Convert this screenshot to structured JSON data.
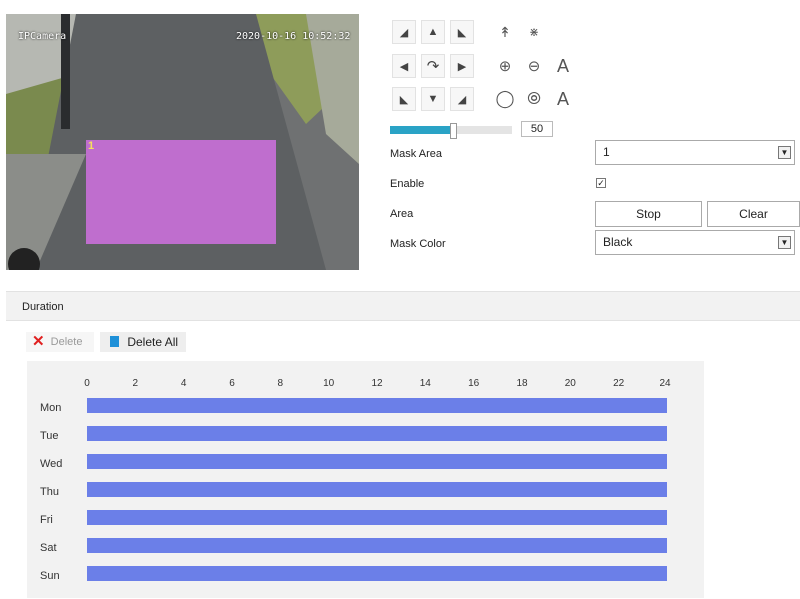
{
  "video": {
    "camera_name": "IPCamera",
    "timestamp": "2020-10-16 10:52:32",
    "mask_number": "1"
  },
  "ptz": {
    "icons": [
      "arrow-up-left-icon",
      "arrow-up-icon",
      "arrow-up-right-icon",
      "tree-icon",
      "fence-icon",
      "arrow-left-icon",
      "redo-icon",
      "arrow-right-icon",
      "zoom-in-icon",
      "zoom-out-icon",
      "focus-a-icon",
      "arrow-down-left-icon",
      "arrow-down-icon",
      "arrow-down-right-icon",
      "iris-open-icon",
      "iris-close-icon",
      "auto-a-icon"
    ],
    "speed": 50,
    "speed_label": "50"
  },
  "form": {
    "mask_area_label": "Mask Area",
    "mask_area_value": "1",
    "enable_label": "Enable",
    "enable_checked": true,
    "area_label": "Area",
    "stop_label": "Stop",
    "clear_label": "Clear",
    "mask_color_label": "Mask Color",
    "mask_color_value": "Black"
  },
  "duration": {
    "title": "Duration",
    "delete_label": "Delete",
    "delete_all_label": "Delete All",
    "hours": [
      "0",
      "2",
      "4",
      "6",
      "8",
      "10",
      "12",
      "14",
      "16",
      "18",
      "20",
      "22",
      "24"
    ],
    "days": [
      "Mon",
      "Tue",
      "Wed",
      "Thu",
      "Fri",
      "Sat",
      "Sun"
    ]
  },
  "colors": {
    "accent": "#2aa3c6",
    "mask": "#c76fd6",
    "schedule_bar": "#6b7fe8",
    "delete_x": "#e02020"
  }
}
